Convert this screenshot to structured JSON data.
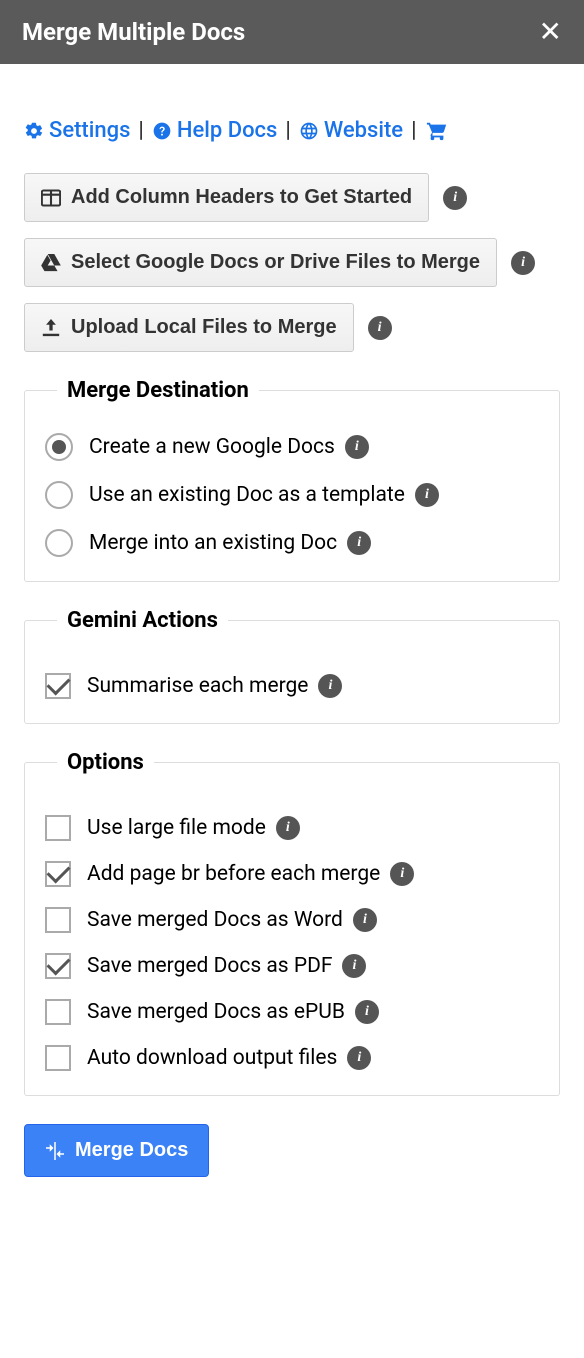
{
  "header": {
    "title": "Merge Multiple Docs"
  },
  "links": {
    "settings": "Settings",
    "helpDocs": "Help Docs",
    "website": "Website"
  },
  "actions": {
    "addHeaders": "Add Column Headers to Get Started",
    "selectDocs": "Select Google Docs or Drive Files to Merge",
    "uploadLocal": "Upload Local Files to Merge"
  },
  "mergeDestination": {
    "legend": "Merge Destination",
    "createNew": "Create a new Google Docs",
    "useTemplate": "Use an existing Doc as a template",
    "mergeExisting": "Merge into an existing Doc"
  },
  "gemini": {
    "legend": "Gemini Actions",
    "summarise": "Summarise each merge"
  },
  "options": {
    "legend": "Options",
    "largeFile": "Use large file mode",
    "pageBreak": "Add page br before each merge",
    "saveWord": "Save merged Docs as Word",
    "savePdf": "Save merged Docs as PDF",
    "saveEpub": "Save merged Docs as ePUB",
    "autoDownload": "Auto download output files"
  },
  "mergeButton": "Merge Docs"
}
